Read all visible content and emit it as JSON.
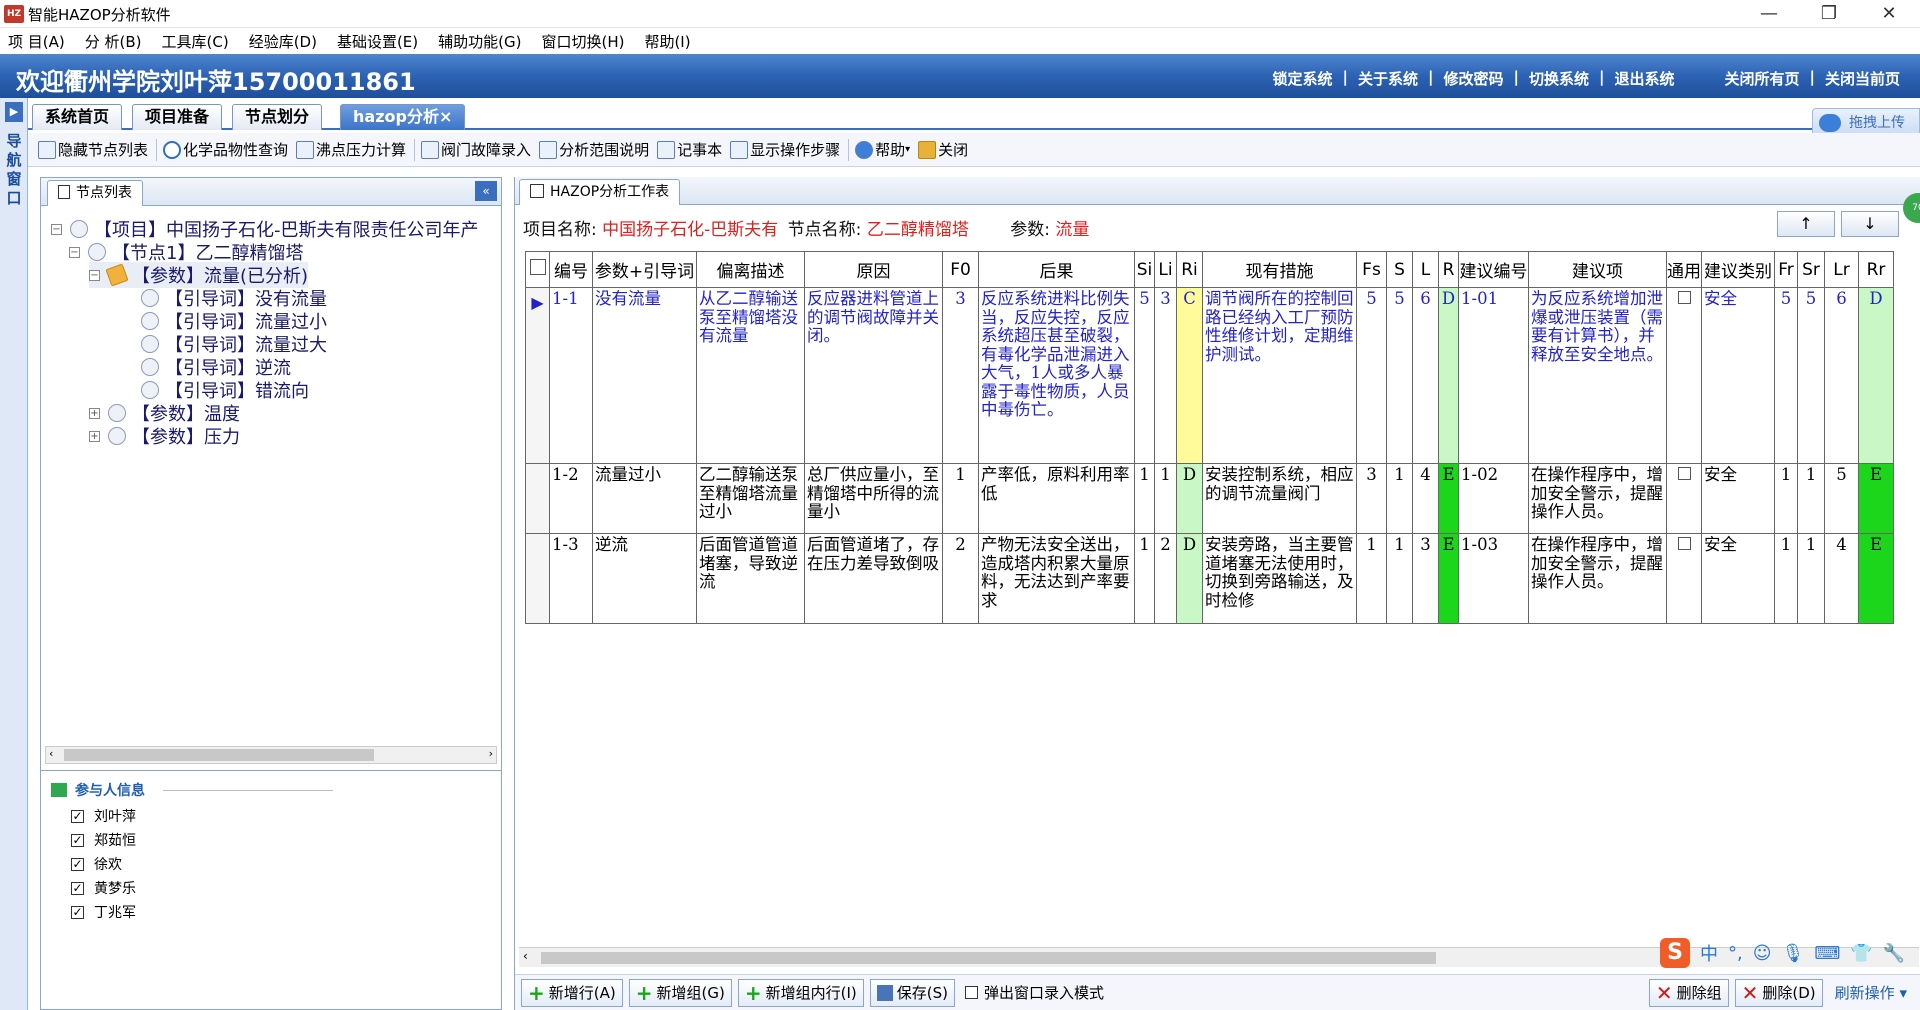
{
  "window": {
    "title": "智能HAZOP分析软件",
    "app_icon": "HZ"
  },
  "menu": [
    "项 目(A)",
    "分 析(B)",
    "工具库(C)",
    "经验库(D)",
    "基础设置(E)",
    "辅助功能(G)",
    "窗口切换(H)",
    "帮助(I)"
  ],
  "banner": {
    "welcome": "欢迎衢州学院刘叶萍15700011861",
    "links": [
      "锁定系统",
      "关于系统",
      "修改密码",
      "切换系统",
      "退出系统"
    ],
    "right_links": [
      "关闭所有页",
      "关闭当前页"
    ]
  },
  "nav": {
    "label": "导航窗口"
  },
  "tabs": [
    "系统首页",
    "项目准备",
    "节点划分",
    "hazop分析×"
  ],
  "float_upload": "拖拽上传",
  "toolbar": [
    "隐藏节点列表",
    "化学品物性查询",
    "沸点压力计算",
    "阀门故障录入",
    "分析范围说明",
    "记事本",
    "显示操作步骤",
    "帮助",
    "关闭"
  ],
  "left": {
    "tab": "节点列表",
    "tree": [
      {
        "text": "【项目】中国扬子石化-巴斯夫有限责任公司年产",
        "pm": "−"
      },
      {
        "text": "【节点1】乙二醇精馏塔",
        "pm": "−"
      },
      {
        "text": "【参数】流量(已分析)",
        "pm": "−"
      },
      {
        "text": "【引导词】没有流量"
      },
      {
        "text": "【引导词】流量过小"
      },
      {
        "text": "【引导词】流量过大"
      },
      {
        "text": "【引导词】逆流"
      },
      {
        "text": "【引导词】错流向"
      },
      {
        "text": "【参数】温度",
        "pm": "+"
      },
      {
        "text": "【参数】压力",
        "pm": "+"
      }
    ],
    "participants_title": "参与人信息",
    "participants": [
      "刘叶萍",
      "郑茹恒",
      "徐欢",
      "黄梦乐",
      "丁兆军"
    ]
  },
  "right": {
    "tab": "HAZOP分析工作表",
    "project_label": "项目名称:",
    "project_value": "中国扬子石化-巴斯夫有",
    "node_label": "节点名称:",
    "node_value": "乙二醇精馏塔",
    "param_label": "参数:",
    "param_value": "流量",
    "up": "↑",
    "down": "↓",
    "badge": "70"
  },
  "grid": {
    "headers": [
      "编号",
      "参数+引导词",
      "偏离描述",
      "原因",
      "F0",
      "后果",
      "Si",
      "Li",
      "Ri",
      "现有措施",
      "Fs",
      "S",
      "L",
      "R",
      "建议编号",
      "建议项",
      "通用",
      "建议类别",
      "Fr",
      "Sr",
      "Lr",
      "Rr"
    ],
    "rows": [
      [
        "1-1",
        "没有流量",
        "从乙二醇输送泵至精馏塔没有流量",
        "反应器进料管道上的调节阀故障并关闭。",
        "3",
        "反应系统进料比例失当，反应失控，反应系统超压甚至破裂，有毒化学品泄漏进入大气，1人或多人暴露于毒性物质，人员中毒伤亡。",
        "5",
        "3",
        "C",
        "调节阀所在的控制回路已经纳入工厂预防性维修计划，定期维护测试。",
        "5",
        "5",
        "6",
        "D",
        "1-01",
        "为反应系统增加泄爆或泄压装置（需要有计算书），并释放至安全地点。",
        "",
        "安全",
        "5",
        "5",
        "6",
        "D"
      ],
      [
        "1-2",
        "流量过小",
        "乙二醇输送泵至精馏塔流量过小",
        "总厂供应量小，至精馏塔中所得的流量小",
        "1",
        "产率低，原料利用率低",
        "1",
        "1",
        "D",
        "安装控制系统，相应的调节流量阀门",
        "3",
        "1",
        "4",
        "E",
        "1-02",
        "在操作程序中，增加安全警示，提醒操作人员。",
        "",
        "安全",
        "1",
        "1",
        "5",
        "E"
      ],
      [
        "1-3",
        "逆流",
        "后面管道管道堵塞，导致逆流",
        "后面管道堵了，存在压力差导致倒吸",
        "2",
        "产物无法安全送出，造成塔内积累大量原料，无法达到产率要求",
        "1",
        "2",
        "D",
        "安装旁路，当主要管道堵塞无法使用时，切换到旁路输送，及时检修",
        "1",
        "1",
        "3",
        "E",
        "1-03",
        "在操作程序中，增加安全警示，提醒操作人员。",
        "",
        "安全",
        "1",
        "1",
        "4",
        "E"
      ]
    ],
    "row_colors": {
      "ri": [
        "#fffb9a",
        "#c9f7c5",
        "#c9f7c5"
      ],
      "r": [
        "#c9f7c5",
        "#1bd61b",
        "#1bd61b"
      ],
      "rr": [
        "#c9f7c5",
        "#1bd61b",
        "#1bd61b"
      ]
    }
  },
  "bottom": {
    "add_row": "新增行(A)",
    "add_group": "新增组(G)",
    "add_in_group": "新增组内行(I)",
    "save": "保存(S)",
    "popup_mode": "弹出窗口录入模式",
    "delete_group": "删除组",
    "delete": "删除(D)",
    "refresh": "刷新操作"
  },
  "ime": {
    "logo": "S",
    "mode": "中"
  }
}
